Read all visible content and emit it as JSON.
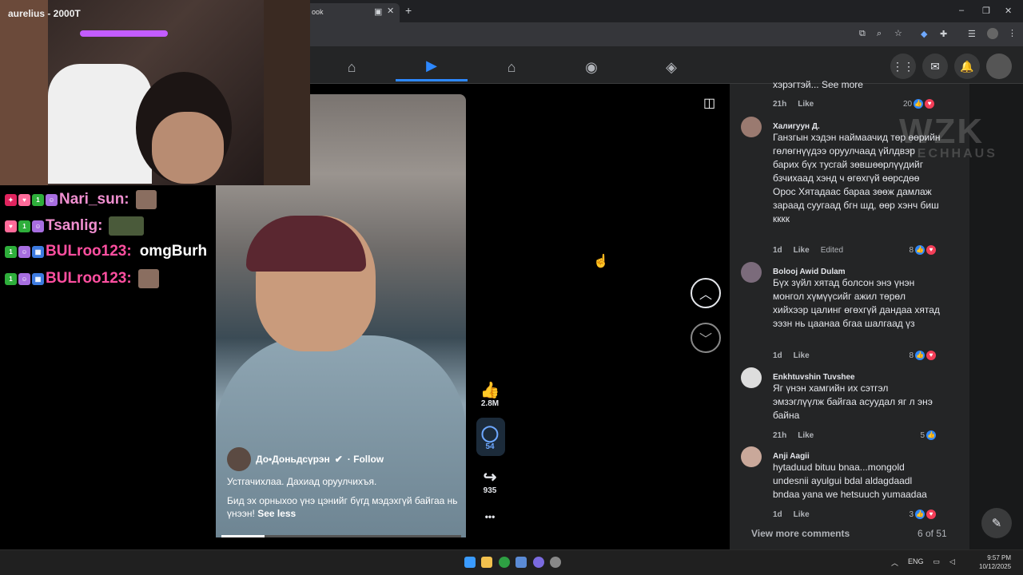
{
  "browser": {
    "tab_title": "ook",
    "new_tab": "+",
    "window_controls": [
      "–",
      "❐",
      "✕"
    ],
    "toolbar_icons": [
      "cast-icon",
      "zoom-icon",
      "star-icon",
      "extension-icon",
      "puzzle-icon",
      "list-icon",
      "profile-icon",
      "menu-icon"
    ]
  },
  "nav": {
    "tabs": [
      {
        "name": "home",
        "icon": "⌂"
      },
      {
        "name": "reels",
        "icon": "▶"
      },
      {
        "name": "marketplace",
        "icon": "⌂"
      },
      {
        "name": "groups",
        "icon": "◉"
      },
      {
        "name": "gaming",
        "icon": "◈"
      }
    ],
    "right": {
      "menu": "⋮⋮",
      "messenger": "✉",
      "notifications": "🔔"
    }
  },
  "stream": {
    "cam_name": "aurelius - 2000T",
    "chat": [
      {
        "user": "Nari_sun:",
        "color": "#f08fd0",
        "msg": ""
      },
      {
        "user": "Tsanlig:",
        "color": "#f08fd0",
        "msg": ""
      },
      {
        "user": "BULroo123:",
        "color": "#ff4fa0",
        "msg": "omgBurh"
      },
      {
        "user": "BULroo123:",
        "color": "#ff4fa0",
        "msg": ""
      }
    ]
  },
  "reel": {
    "author": "До•Доньдсүрэн",
    "follow": "· Follow",
    "caption_line1": "Устгачихлаа. Дахиад оруулчихъя.",
    "caption_line2": "Бид эх орныхоо үнэ цэнийг бүгд мэдэхгүй байгаа нь үнээн!",
    "see_less": "See less",
    "likes": "2.8M",
    "comments": "54",
    "shares": "935",
    "more": "•••",
    "progress": 0.18
  },
  "comments": {
    "top_snippet": "хэрэгтэй... See more",
    "top_meta": {
      "time": "21h",
      "like": "Like",
      "count": "20"
    },
    "items": [
      {
        "name": "Халигуун Д.",
        "text": "Ганзгын хэдэн наймаачид төр өөрийн гөлөгнүүдээ оруулчаад үйлдвэр барих бүх тусгай зөвшөөрлүүдийг бзчихаад хэнд ч өгөхгүй өөрсдөө Орос Хятадаас бараа зөөж дамлаж зараад суугаад бгн шд, өөр хэнч биш кккк",
        "time": "1d",
        "like": "Like",
        "edited": "Edited",
        "count": "8"
      },
      {
        "name": "Bolooj Awid Dulam",
        "text": "Бүх зүйл хятад болсон энэ үнэн монгол хүмүүсийг ажил төрөл хийхээр цалинг өгөхгүй дандаа хятад ээзн нь цаанаа бгаа шалгаад үз",
        "time": "1d",
        "like": "Like",
        "edited": "",
        "count": "8"
      },
      {
        "name": "Enkhtuvshin Tuvshee",
        "text": "Яг үнэн хамгийн их сэтгэл эмзэглүүлж байгаа асуудал яг л энэ байна",
        "time": "21h",
        "like": "Like",
        "edited": "",
        "count": "5"
      },
      {
        "name": "Anji Aagii",
        "text": "hytaduud bituu bnaa...mongold undesnii ayulgui bdal aldagdaadl bndaa yana we hetsuuch yumaadaa",
        "time": "1d",
        "like": "Like",
        "edited": "",
        "count": "3"
      }
    ],
    "view_more": "View more comments",
    "pager": "6 of 51"
  },
  "watermark": {
    "line1": "WZK",
    "line2": "TECHHAUS"
  },
  "taskbar": {
    "lang": "ENG",
    "time": "9:57 PM",
    "date": "10/12/2025"
  }
}
